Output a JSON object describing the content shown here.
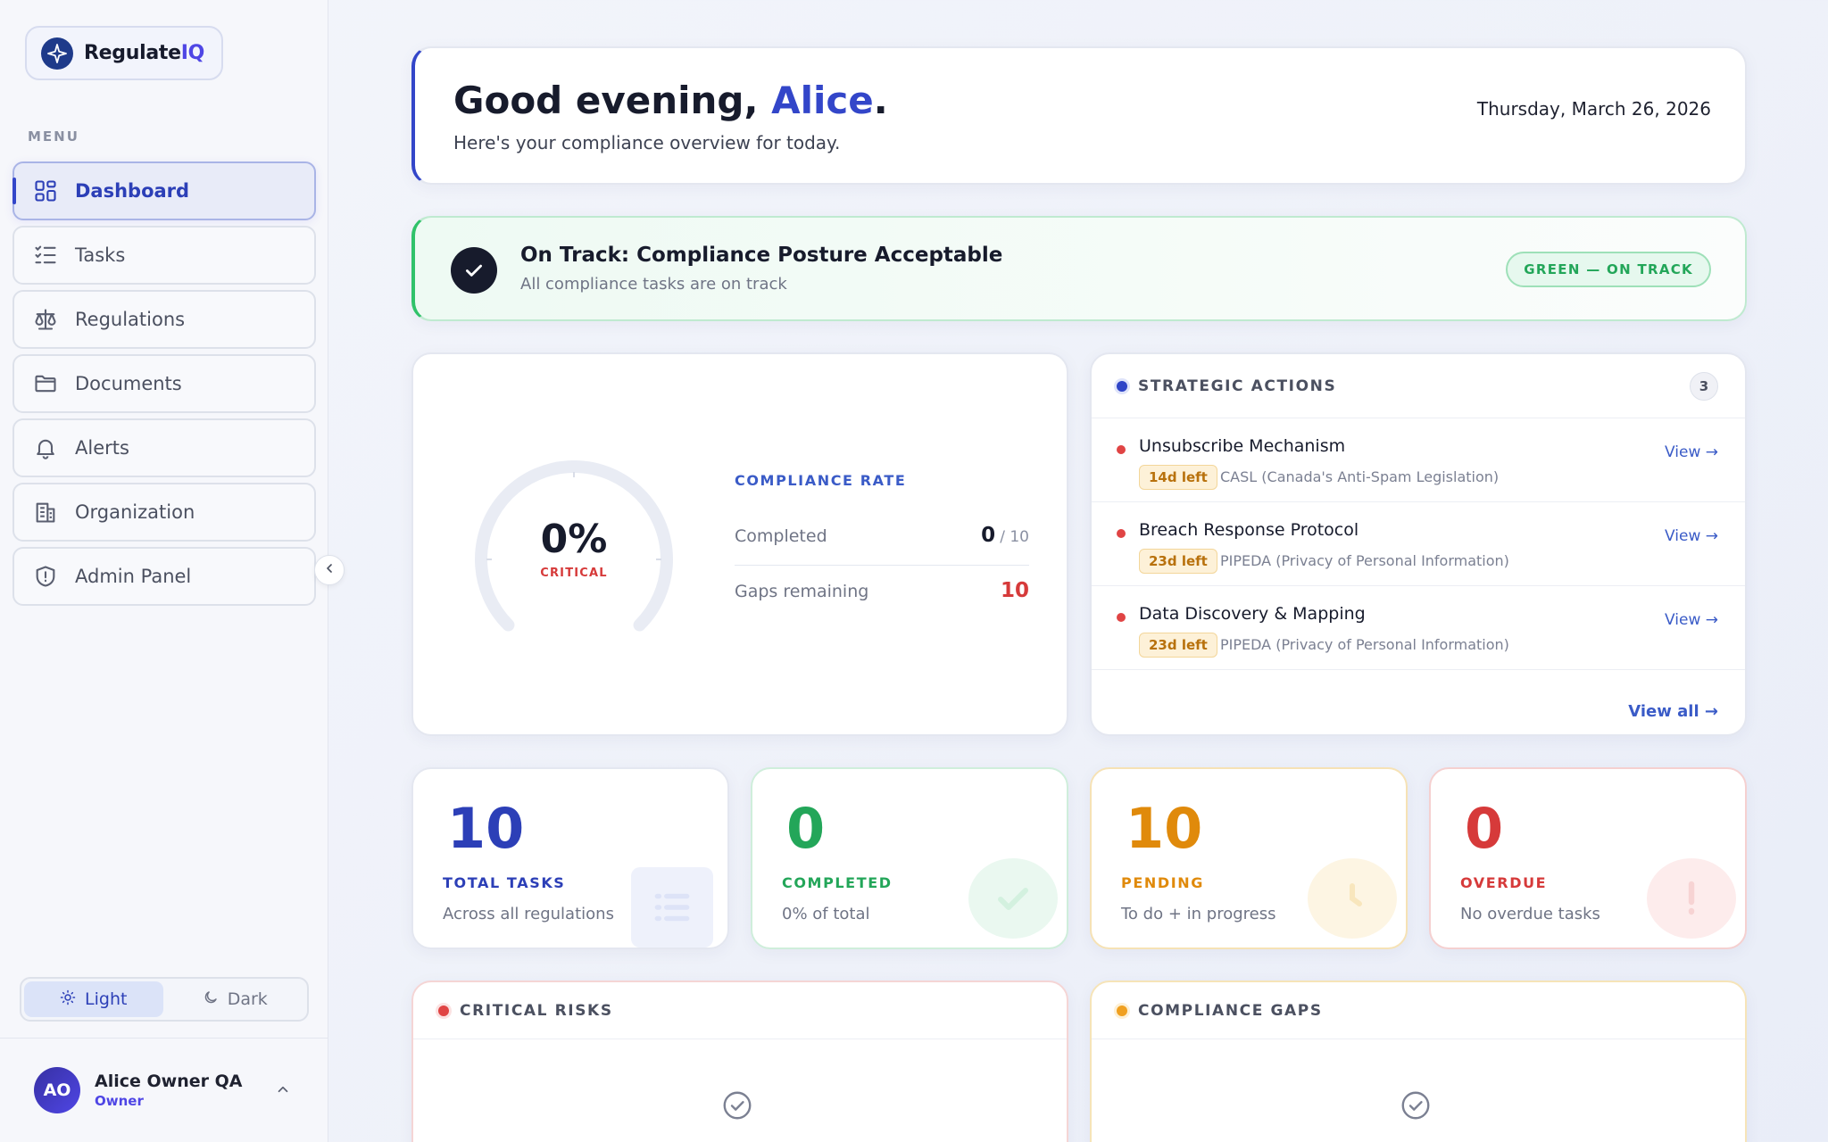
{
  "brand": {
    "name_main": "Regulate",
    "name_accent": "IQ"
  },
  "sidebar": {
    "menu_label": "MENU",
    "items": [
      {
        "label": "Dashboard",
        "icon": "grid-icon",
        "active": true
      },
      {
        "label": "Tasks",
        "icon": "checklist-icon"
      },
      {
        "label": "Regulations",
        "icon": "scale-icon"
      },
      {
        "label": "Documents",
        "icon": "folder-icon"
      },
      {
        "label": "Alerts",
        "icon": "bell-icon"
      },
      {
        "label": "Organization",
        "icon": "building-icon"
      },
      {
        "label": "Admin Panel",
        "icon": "shield-icon"
      }
    ],
    "theme": {
      "light": "Light",
      "dark": "Dark",
      "selected": "Light"
    },
    "user": {
      "initials": "AO",
      "name": "Alice Owner QA",
      "role": "Owner"
    }
  },
  "greeting": {
    "prefix": "Good evening, ",
    "name": "Alice",
    "suffix": ".",
    "subtitle": "Here's your compliance overview for today.",
    "date": "Thursday, March 26, 2026"
  },
  "status": {
    "title": "On Track: Compliance Posture Acceptable",
    "subtitle": "All compliance tasks are on track",
    "pill": "GREEN — ON TRACK"
  },
  "compliance": {
    "value": "0%",
    "level": "CRITICAL",
    "rate_fraction": 0,
    "heading": "COMPLIANCE RATE",
    "completed_label": "Completed",
    "completed_value": "0",
    "completed_total": "/ 10",
    "gaps_label": "Gaps remaining",
    "gaps_value": "10"
  },
  "strategic": {
    "title": "STRATEGIC ACTIONS",
    "count": "3",
    "actions": [
      {
        "title": "Unsubscribe Mechanism",
        "tag": "14d left",
        "regulation": "CASL (Canada's Anti-Spam Legislation)",
        "view": "View →"
      },
      {
        "title": "Breach Response Protocol",
        "tag": "23d left",
        "regulation": "PIPEDA (Privacy of Personal Information)",
        "view": "View →"
      },
      {
        "title": "Data Discovery & Mapping",
        "tag": "23d left",
        "regulation": "PIPEDA (Privacy of Personal Information)",
        "view": "View →"
      }
    ],
    "view_all": "View all →"
  },
  "stats": [
    {
      "value": "10",
      "label": "TOTAL TASKS",
      "desc": "Across all regulations",
      "color": "#2c3fb7"
    },
    {
      "value": "0",
      "label": "COMPLETED",
      "desc": "0% of total",
      "color": "#23a659"
    },
    {
      "value": "10",
      "label": "PENDING",
      "desc": "To do + in progress",
      "color": "#e08a0b"
    },
    {
      "value": "0",
      "label": "OVERDUE",
      "desc": "No overdue tasks",
      "color": "#d63a3a"
    }
  ],
  "critical_risks": {
    "title": "CRITICAL RISKS"
  },
  "compliance_gaps": {
    "title": "COMPLIANCE GAPS"
  }
}
